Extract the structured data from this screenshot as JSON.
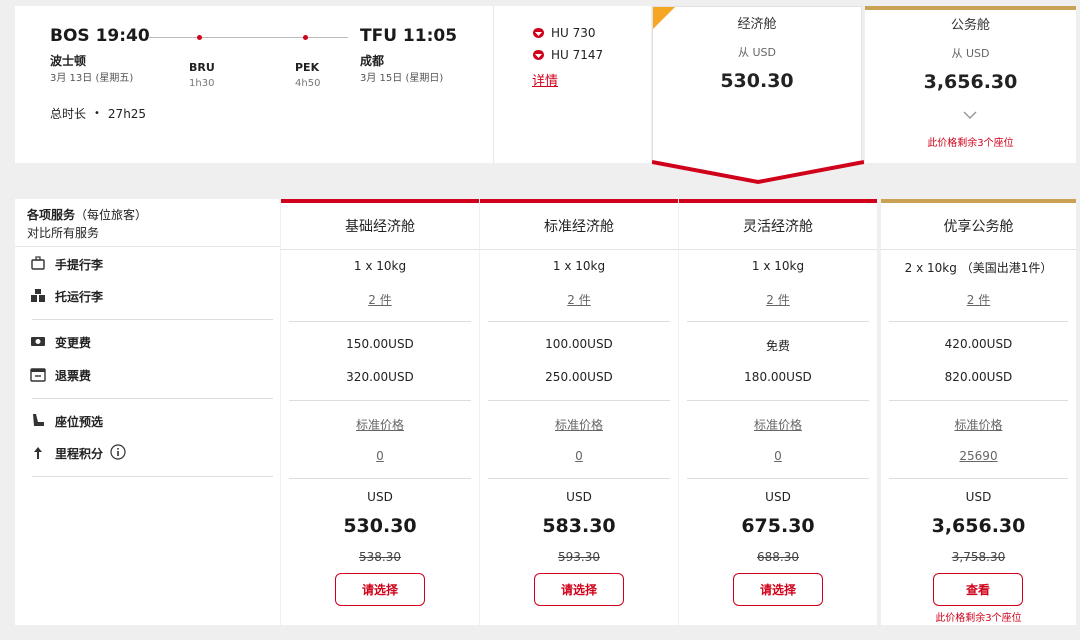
{
  "flight": {
    "origin": {
      "time": "BOS 19:40",
      "city": "波士顿",
      "date": "3月 13日 (星期五)"
    },
    "destination": {
      "time": "TFU 11:05",
      "city": "成都",
      "date": "3月 15日 (星期日)"
    },
    "stops": [
      {
        "code": "BRU",
        "duration": "1h30"
      },
      {
        "code": "PEK",
        "duration": "4h50"
      }
    ],
    "total_label": "总时长",
    "total_value": "27h25",
    "flight_numbers": [
      "HU 730",
      "HU 7147"
    ],
    "details_label": "详情"
  },
  "fare_summary": {
    "economy": {
      "name": "经济舱",
      "from": "从 USD",
      "price": "530.30"
    },
    "business": {
      "name": "公务舱",
      "from": "从 USD",
      "price": "3,656.30",
      "seats_note": "此价格剩余3个座位"
    }
  },
  "table": {
    "header_title": "各项服务",
    "header_sub": "（每位旅客）",
    "header_compare": "对比所有服务",
    "features": [
      "手提行李",
      "托运行李",
      "变更费",
      "退票费",
      "座位预选",
      "里程积分"
    ],
    "columns": [
      {
        "name": "基础经济舱",
        "carryon": "1 x 10kg",
        "checked": "2 件",
        "change": "150.00USD",
        "refund": "320.00USD",
        "seat": "标准价格",
        "miles": "0",
        "currency": "USD",
        "price": "530.30",
        "old_price": "538.30",
        "button": "请选择"
      },
      {
        "name": "标准经济舱",
        "carryon": "1 x 10kg",
        "checked": "2 件",
        "change": "100.00USD",
        "refund": "250.00USD",
        "seat": "标准价格",
        "miles": "0",
        "currency": "USD",
        "price": "583.30",
        "old_price": "593.30",
        "button": "请选择"
      },
      {
        "name": "灵活经济舱",
        "carryon": "1 x 10kg",
        "checked": "2 件",
        "change": "免费",
        "refund": "180.00USD",
        "seat": "标准价格",
        "miles": "0",
        "currency": "USD",
        "price": "675.30",
        "old_price": "688.30",
        "button": "请选择"
      },
      {
        "name": "优享公务舱",
        "carryon": "2 x 10kg （美国出港1件）",
        "checked": "2 件",
        "change": "420.00USD",
        "refund": "820.00USD",
        "seat": "标准价格",
        "miles": "25690",
        "currency": "USD",
        "price": "3,656.30",
        "old_price": "3,758.30",
        "button": "查看",
        "seats_note": "此价格剩余3个座位"
      }
    ]
  },
  "colors": {
    "accent_red": "#d0021b",
    "gold": "#c9a256",
    "orange_corner": "#f5a623"
  }
}
